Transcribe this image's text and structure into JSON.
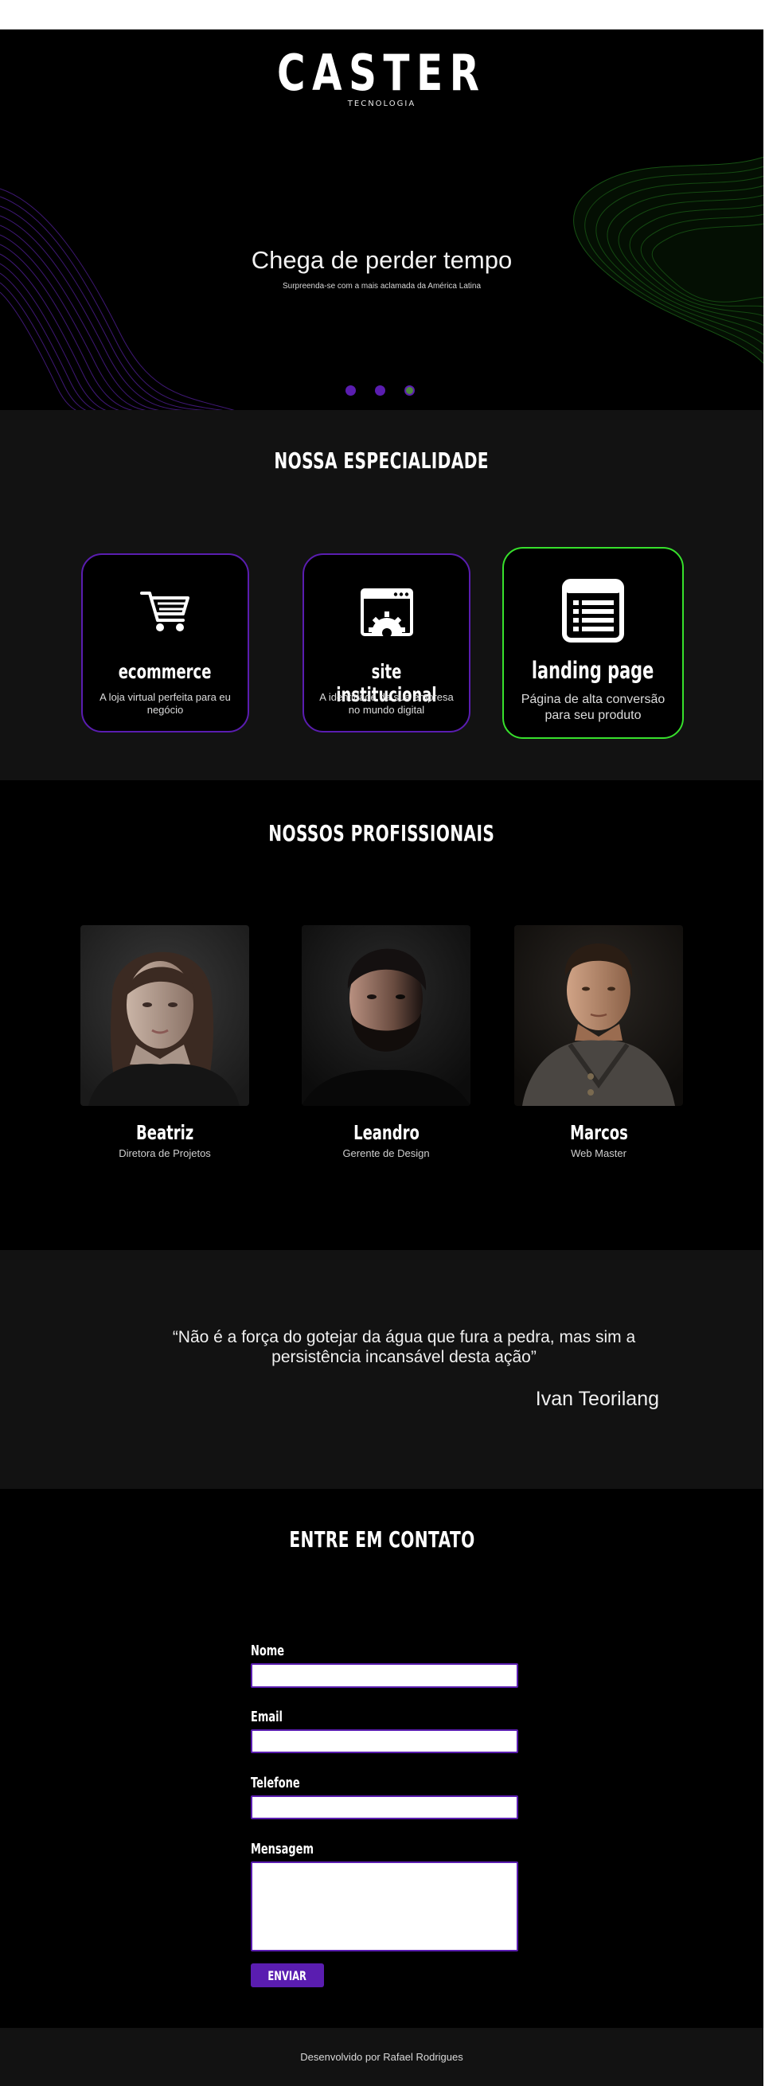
{
  "brand": {
    "name": "CASTER",
    "tagline": "TECNOLOGIA"
  },
  "hero": {
    "title": "Chega de perder tempo",
    "subtitle": "Surpreenda-se com a mais aclamada da América Latina",
    "slides_count": 3,
    "active_slide": 3
  },
  "specialty": {
    "title": "NOSSA ESPECIALIDADE",
    "cards": [
      {
        "icon": "cart-icon",
        "title": "ecommerce",
        "description": "A loja virtual perfeita para eu negócio",
        "highlighted": false
      },
      {
        "icon": "browser-gear-icon",
        "title": "site institucional",
        "description": "A identidade da sua empresa no mundo digital",
        "highlighted": false
      },
      {
        "icon": "landing-page-icon",
        "title": "landing page",
        "description": "Página de alta conversão para seu produto",
        "highlighted": true
      }
    ]
  },
  "professionals": {
    "title": "NOSSOS PROFISSIONAIS",
    "people": [
      {
        "name": "Beatriz",
        "role": "Diretora de Projetos"
      },
      {
        "name": "Leandro",
        "role": "Gerente de Design"
      },
      {
        "name": "Marcos",
        "role": "Web Master"
      }
    ]
  },
  "quote": {
    "text": "“Não é a força do gotejar da água que fura a pedra, mas sim a persistência incansável desta ação”",
    "author": "Ivan Teorilang"
  },
  "contact": {
    "title": "ENTRE EM CONTATO",
    "fields": {
      "name_label": "Nome",
      "email_label": "Email",
      "phone_label": "Telefone",
      "message_label": "Mensagem",
      "name_value": "",
      "email_value": "",
      "phone_value": "",
      "message_value": ""
    },
    "submit_label": "ENVIAR"
  },
  "footer": {
    "text": "Desenvolvido por Rafael Rodrigues"
  },
  "colors": {
    "accent_purple": "#5a1db0",
    "accent_green": "#37e02c",
    "background": "#000000",
    "section_alt": "#121212"
  }
}
